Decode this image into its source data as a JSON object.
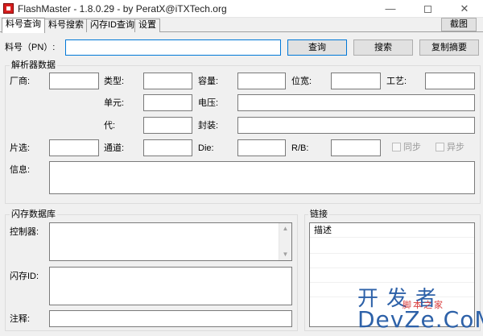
{
  "window": {
    "title": "FlashMaster - 1.8.0.29 - by PeratX@iTXTech.org",
    "minimize_glyph": "—",
    "close_glyph": "✕"
  },
  "tabs": [
    {
      "label": "料号查询"
    },
    {
      "label": "料号搜索"
    },
    {
      "label": "闪存ID查询"
    },
    {
      "label": "设置"
    }
  ],
  "screenshot_button": "截图",
  "search": {
    "label": "料号（PN）:",
    "value": "",
    "query_button": "查询",
    "search_button": "搜索",
    "copy_button": "复制摘要"
  },
  "parser": {
    "title": "解析器数据",
    "vendor_label": "厂商:",
    "type_label": "类型:",
    "capacity_label": "容量:",
    "bitwidth_label": "位宽:",
    "process_label": "工艺:",
    "cell_label": "单元:",
    "voltage_label": "电压:",
    "generation_label": "代:",
    "package_label": "封装:",
    "ce_label": "片选:",
    "channel_label": "通道:",
    "die_label": "Die:",
    "rb_label": "R/B:",
    "sync_label": "同步",
    "async_label": "异步",
    "info_label": "信息:"
  },
  "flashdb": {
    "title": "闪存数据库",
    "controller_label": "控制器:",
    "flashid_label": "闪存ID:",
    "comment_label": "注释:"
  },
  "links": {
    "title": "链接",
    "column_header": "描述"
  },
  "colors": {
    "accent": "#0078d7",
    "app_icon": "#d71f1f"
  }
}
